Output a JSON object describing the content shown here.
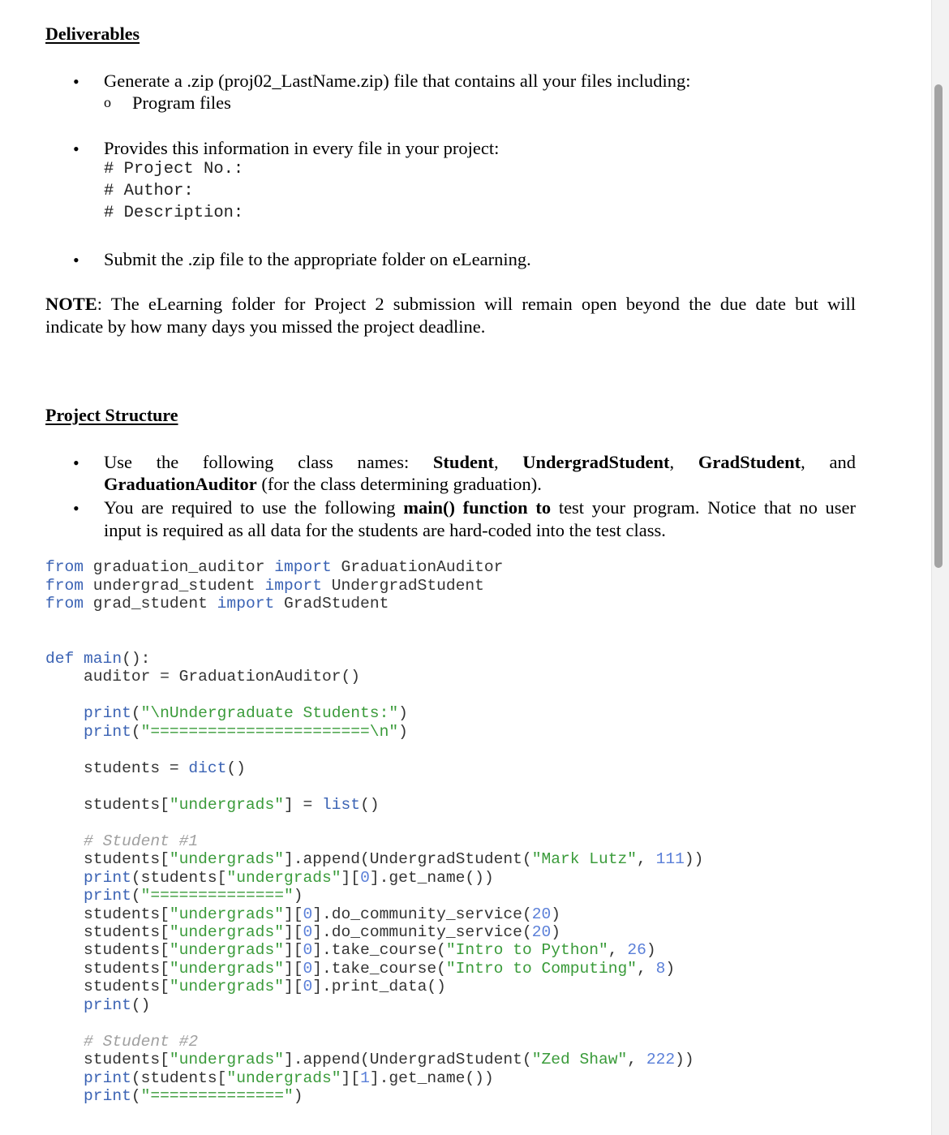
{
  "deliverables": {
    "heading": "Deliverables",
    "bullet1": "Generate a .zip (proj02_LastName.zip) file that contains all your files including:",
    "sub_bullet_marker": "o",
    "sub_bullet1": "Program files",
    "bullet2": "Provides this information in every file in your project:",
    "header_lines": [
      "# Project No.:",
      "# Author:",
      "# Description:"
    ],
    "bullet3": "Submit the .zip file to the appropriate folder on eLearning."
  },
  "note": {
    "label": "NOTE",
    "line1": ": The eLearning folder for Project 2 submission will remain open beyond the due date but will",
    "line2": "indicate by how many days you missed the project deadline."
  },
  "project_structure": {
    "heading": "Project Structure",
    "b1_pre": "Use the following class names: ",
    "class1": "Student",
    "class2": "UndergradStudent",
    "class3": "GradStudent",
    "b1_and": "and",
    "class4": "GraduationAuditor",
    "b1_post": " (for the class determining graduation).",
    "b2_pre": "You are required to use the following ",
    "b2_bold": "main() function to",
    "b2_post": " test your program. Notice that no user",
    "b2_line2": "input is required as all data for the students are hard-coded into the test class."
  },
  "code": {
    "imports": [
      {
        "kw1": "from",
        "mod": " graduation_auditor ",
        "kw2": "import",
        "cls": " GraduationAuditor"
      },
      {
        "kw1": "from",
        "mod": " undergrad_student ",
        "kw2": "import",
        "cls": " UndergradStudent"
      },
      {
        "kw1": "from",
        "mod": " grad_student ",
        "kw2": "import",
        "cls": " GradStudent"
      }
    ],
    "def_kw": "def",
    "func_name": " main",
    "func_tail": "():",
    "auditor_line": "    auditor = GraduationAuditor()",
    "print_kw": "print",
    "header_str1": "\"\\nUndergraduate Students:\"",
    "header_str2": "\"=======================\\n\"",
    "students_assign": "    students = ",
    "dict_kw": "dict",
    "undergrads_key": "\"undergrads\"",
    "list_kw": "list",
    "comment1": "# Student #1",
    "name1": "\"Mark Lutz\"",
    "id1": "111",
    "idx0": "0",
    "sep_str": "\"==============\"",
    "service_hours": "20",
    "course1": "\"Intro to Python\"",
    "course1_credits": "26",
    "course2": "\"Intro to Computing\"",
    "course2_credits": "8",
    "comment2": "# Student #2",
    "name2": "\"Zed Shaw\"",
    "id2": "222",
    "idx1": "1"
  }
}
